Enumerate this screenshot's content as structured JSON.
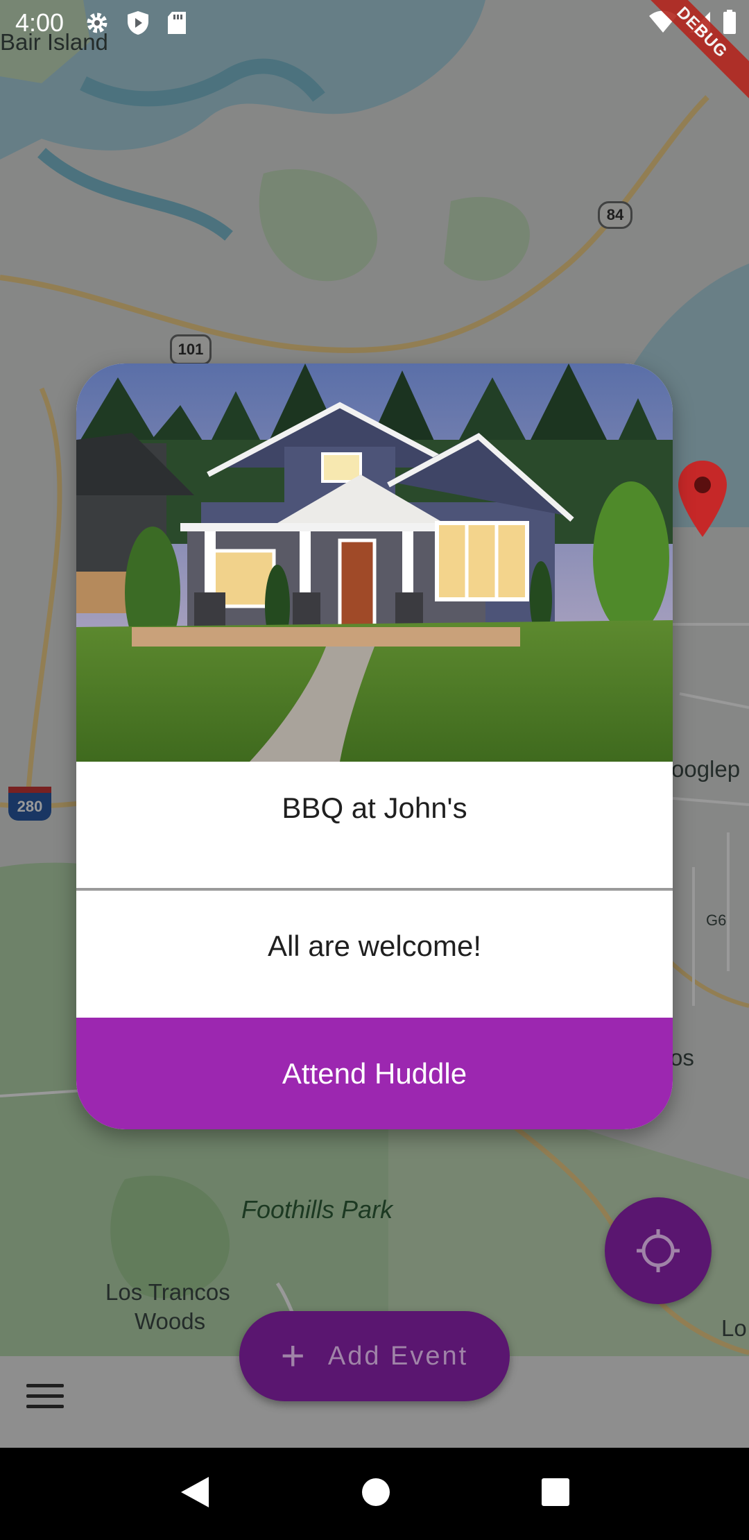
{
  "status_bar": {
    "time": "4:00"
  },
  "debug_banner": "DEBUG",
  "map": {
    "labels": {
      "bair_island": "Bair Island",
      "googleplex_partial": "ooglep",
      "foothills_park": "Foothills Park",
      "los_trancos": "Los Trancos",
      "woods": "Woods",
      "los_partial": "os",
      "lo_partial": "Lo",
      "g6": "G6"
    },
    "shields": {
      "us101": "101",
      "ca84": "84",
      "i280": "280"
    }
  },
  "dialog": {
    "title": "BBQ at John's",
    "description": "All are welcome!",
    "attend_label": "Attend Huddle"
  },
  "fab": {
    "add_event_label": "Add Event"
  },
  "colors": {
    "accent": "#9c27b0",
    "fab": "#5a1670",
    "pin": "#c62828"
  }
}
